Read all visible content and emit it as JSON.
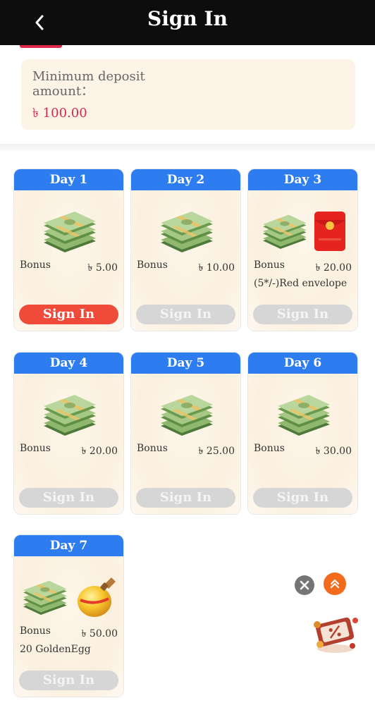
{
  "header": {
    "title": "Sign In"
  },
  "deposit": {
    "label": "Minimum deposit amount：",
    "value": "৳ 100.00"
  },
  "days": [
    {
      "title": "Day 1",
      "bonus_label": "Bonus",
      "bonus_value": "৳ 5.00",
      "extra": "",
      "button": "Sign In",
      "state": "active",
      "rewards": [
        "cash-stack-icon"
      ]
    },
    {
      "title": "Day 2",
      "bonus_label": "Bonus",
      "bonus_value": "৳ 10.00",
      "extra": "",
      "button": "Sign In",
      "state": "disabled",
      "rewards": [
        "cash-stack-icon"
      ]
    },
    {
      "title": "Day 3",
      "bonus_label": "Bonus",
      "bonus_value": "৳ 20.00",
      "extra": "(5*/-)Red envelope",
      "button": "Sign In",
      "state": "disabled",
      "rewards": [
        "cash-stack-icon",
        "red-envelope-icon"
      ]
    },
    {
      "title": "Day 4",
      "bonus_label": "Bonus",
      "bonus_value": "৳ 20.00",
      "extra": "",
      "button": "Sign In",
      "state": "disabled",
      "rewards": [
        "cash-stack-icon"
      ]
    },
    {
      "title": "Day 5",
      "bonus_label": "Bonus",
      "bonus_value": "৳ 25.00",
      "extra": "",
      "button": "Sign In",
      "state": "disabled",
      "rewards": [
        "cash-stack-icon"
      ]
    },
    {
      "title": "Day 6",
      "bonus_label": "Bonus",
      "bonus_value": "৳ 30.00",
      "extra": "",
      "button": "Sign In",
      "state": "disabled",
      "rewards": [
        "cash-stack-icon"
      ]
    },
    {
      "title": "Day 7",
      "bonus_label": "Bonus",
      "bonus_value": "৳ 50.00",
      "extra": "20 GoldenEgg",
      "button": "Sign In",
      "state": "disabled",
      "rewards": [
        "cash-stack-icon",
        "golden-egg-icon"
      ]
    }
  ],
  "colors": {
    "header_bg": "#0d0d0d",
    "day_header": "#2d7cf0",
    "active_button": "#ef4a3a",
    "disabled_button": "#d6d6d6",
    "amount": "#d62a4d"
  },
  "floating": {
    "close_icon": "close-icon",
    "scroll_top_icon": "double-chevron-up-icon",
    "promo_icon": "discount-coupon-icon"
  }
}
